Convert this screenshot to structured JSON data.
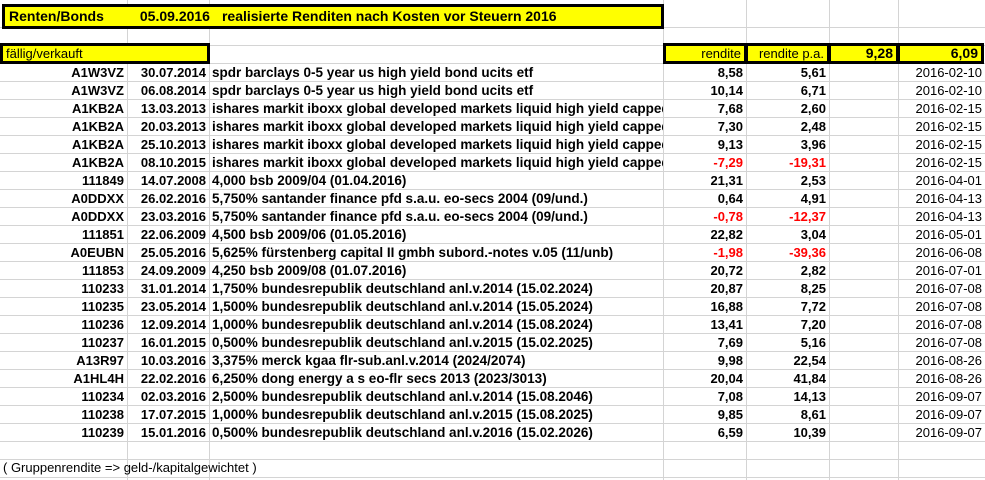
{
  "title": {
    "section": "Renten/Bonds",
    "date": "05.09.2016",
    "text": "realisierte Renditen nach Kosten vor Steuern 2016"
  },
  "header": {
    "label": "fällig/verkauft",
    "rendite": "rendite",
    "rendite_pa": "rendite p.a.",
    "total_rendite": "9,28",
    "total_rendite_pa": "6,09"
  },
  "colors": {
    "highlight": "#ffff00",
    "negative": "#ff0000",
    "border": "#000000"
  },
  "rows": [
    {
      "wkn": "A1W3VZ",
      "date": "30.07.2014",
      "name": "spdr barclays 0-5 year us high yield bond ucits etf",
      "rendite": "8,58",
      "rendite_pa": "5,61",
      "sold": "2016-02-10"
    },
    {
      "wkn": "A1W3VZ",
      "date": "06.08.2014",
      "name": "spdr barclays 0-5 year us high yield bond ucits etf",
      "rendite": "10,14",
      "rendite_pa": "6,71",
      "sold": "2016-02-10"
    },
    {
      "wkn": "A1KB2A",
      "date": "13.03.2013",
      "name": "ishares markit iboxx global developed markets liquid high yield capped",
      "rendite": "7,68",
      "rendite_pa": "2,60",
      "sold": "2016-02-15"
    },
    {
      "wkn": "A1KB2A",
      "date": "20.03.2013",
      "name": "ishares markit iboxx global developed markets liquid high yield capped",
      "rendite": "7,30",
      "rendite_pa": "2,48",
      "sold": "2016-02-15"
    },
    {
      "wkn": "A1KB2A",
      "date": "25.10.2013",
      "name": "ishares markit iboxx global developed markets liquid high yield capped",
      "rendite": "9,13",
      "rendite_pa": "3,96",
      "sold": "2016-02-15"
    },
    {
      "wkn": "A1KB2A",
      "date": "08.10.2015",
      "name": "ishares markit iboxx global developed markets liquid high yield capped",
      "rendite": "-7,29",
      "rendite_pa": "-19,31",
      "sold": "2016-02-15"
    },
    {
      "wkn": "111849",
      "date": "14.07.2008",
      "name": "4,000 bsb 2009/04 (01.04.2016)",
      "rendite": "21,31",
      "rendite_pa": "2,53",
      "sold": "2016-04-01"
    },
    {
      "wkn": "A0DDXX",
      "date": "26.02.2016",
      "name": "5,750% santander finance pfd s.a.u. eo-secs 2004 (09/und.)",
      "rendite": "0,64",
      "rendite_pa": "4,91",
      "sold": "2016-04-13"
    },
    {
      "wkn": "A0DDXX",
      "date": "23.03.2016",
      "name": "5,750% santander finance pfd s.a.u. eo-secs 2004 (09/und.)",
      "rendite": "-0,78",
      "rendite_pa": "-12,37",
      "sold": "2016-04-13"
    },
    {
      "wkn": "111851",
      "date": "22.06.2009",
      "name": "4,500 bsb 2009/06 (01.05.2016)",
      "rendite": "22,82",
      "rendite_pa": "3,04",
      "sold": "2016-05-01"
    },
    {
      "wkn": "A0EUBN",
      "date": "25.05.2016",
      "name": "5,625% fürstenberg capital II gmbh subord.-notes v.05 (11/unb)",
      "rendite": "-1,98",
      "rendite_pa": "-39,36",
      "sold": "2016-06-08"
    },
    {
      "wkn": "111853",
      "date": "24.09.2009",
      "name": "4,250 bsb 2009/08 (01.07.2016)",
      "rendite": "20,72",
      "rendite_pa": "2,82",
      "sold": "2016-07-01"
    },
    {
      "wkn": "110233",
      "date": "31.01.2014",
      "name": "1,750% bundesrepublik deutschland anl.v.2014 (15.02.2024)",
      "rendite": "20,87",
      "rendite_pa": "8,25",
      "sold": "2016-07-08"
    },
    {
      "wkn": "110235",
      "date": "23.05.2014",
      "name": "1,500% bundesrepublik deutschland anl.v.2014 (15.05.2024)",
      "rendite": "16,88",
      "rendite_pa": "7,72",
      "sold": "2016-07-08"
    },
    {
      "wkn": "110236",
      "date": "12.09.2014",
      "name": "1,000% bundesrepublik deutschland anl.v.2014 (15.08.2024)",
      "rendite": "13,41",
      "rendite_pa": "7,20",
      "sold": "2016-07-08"
    },
    {
      "wkn": "110237",
      "date": "16.01.2015",
      "name": "0,500% bundesrepublik deutschland anl.v.2015 (15.02.2025)",
      "rendite": "7,69",
      "rendite_pa": "5,16",
      "sold": "2016-07-08"
    },
    {
      "wkn": "A13R97",
      "date": "10.03.2016",
      "name": "3,375% merck kgaa flr-sub.anl.v.2014 (2024/2074)",
      "rendite": "9,98",
      "rendite_pa": "22,54",
      "sold": "2016-08-26"
    },
    {
      "wkn": "A1HL4H",
      "date": "22.02.2016",
      "name": "6,250% dong energy a s eo-flr secs 2013 (2023/3013)",
      "rendite": "20,04",
      "rendite_pa": "41,84",
      "sold": "2016-08-26"
    },
    {
      "wkn": "110234",
      "date": "02.03.2016",
      "name": "2,500% bundesrepublik deutschland anl.v.2014 (15.08.2046)",
      "rendite": "7,08",
      "rendite_pa": "14,13",
      "sold": "2016-09-07"
    },
    {
      "wkn": "110238",
      "date": "17.07.2015",
      "name": "1,000% bundesrepublik deutschland anl.v.2015 (15.08.2025)",
      "rendite": "9,85",
      "rendite_pa": "8,61",
      "sold": "2016-09-07"
    },
    {
      "wkn": "110239",
      "date": "15.01.2016",
      "name": "0,500% bundesrepublik deutschland anl.v.2016 (15.02.2026)",
      "rendite": "6,59",
      "rendite_pa": "10,39",
      "sold": "2016-09-07"
    }
  ],
  "footer": "( Gruppenrendite => geld-/kapitalgewichtet )"
}
